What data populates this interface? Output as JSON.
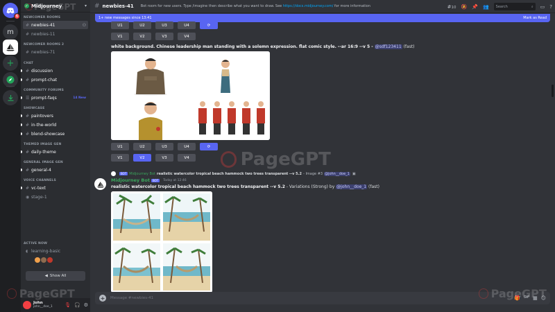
{
  "server": {
    "name": "Midjourney",
    "logo_text": "m",
    "rail_badge": "6"
  },
  "sidebar": {
    "categories": [
      {
        "label": "NEWCOMER ROOMS",
        "channels": [
          {
            "name": "newbies-41"
          },
          {
            "name": "newbies-11"
          }
        ]
      },
      {
        "label": "NEWCOMER ROOMS 2",
        "channels": [
          {
            "name": "newbies-71"
          }
        ]
      },
      {
        "label": "CHAT",
        "channels": [
          {
            "name": "discussion"
          },
          {
            "name": "prompt-chat"
          }
        ]
      },
      {
        "label": "COMMUNITY FORUMS",
        "channels": [
          {
            "name": "prompt-faqs",
            "badge": "14 New"
          }
        ]
      },
      {
        "label": "SHOWCASE",
        "channels": [
          {
            "name": "paintovers"
          },
          {
            "name": "in-the-world"
          },
          {
            "name": "blend-showcase"
          }
        ]
      },
      {
        "label": "THEMED IMAGE GEN",
        "channels": [
          {
            "name": "daily-theme"
          }
        ]
      },
      {
        "label": "GENERAL IMAGE GEN",
        "channels": [
          {
            "name": "general-4"
          }
        ]
      },
      {
        "label": "VOICE CHANNELS",
        "channels": [
          {
            "name": "vc-text"
          },
          {
            "name": "stage-1"
          }
        ]
      },
      {
        "label": "ACTIVE NOW",
        "channels": [
          {
            "name": "learning-basic"
          }
        ]
      }
    ],
    "show_all": "Show All"
  },
  "user": {
    "name": "John",
    "handle": "john__doe_1"
  },
  "topbar": {
    "channel": "newbies-41",
    "topic_prefix": "Bot room for new users. Type /imagine then describe what you want to draw. See ",
    "topic_link": "https://docs.midjourney.com/",
    "topic_suffix": " for more information",
    "count": "10",
    "search_placeholder": "Search"
  },
  "newbar": {
    "text": "1+ new messages since 13:41",
    "mark": "Mark as Read"
  },
  "buttons": {
    "u1": "U1",
    "u2": "U2",
    "u3": "U3",
    "u4": "U4",
    "v1": "V1",
    "v2": "V2",
    "v3": "V3",
    "v4": "V4"
  },
  "message1": {
    "prompt": "white background. Chinese leadership man standing with a solemn expression. flat comic style. --ar 16:9 --v 5 -",
    "mention": "@sdf123411",
    "suffix": "(fast)"
  },
  "message2": {
    "reply_bot": "BOT",
    "reply_name": "Midjourney Bot",
    "reply_text": "realistic watercolor tropical beach hammock two trees transparent --v 5.2",
    "reply_suffix": "- Image #3",
    "reply_mention": "@john__doe_1",
    "author": "Midjourney Bot",
    "bot_tag": "BOT",
    "timestamp": "Today at 12:46",
    "prompt": "realistic watercolor tropical beach hammock two trees transparent --v 5.2",
    "variation_text": "- Variations (Strong) by",
    "mention": "@john__doe_1",
    "suffix": "(fast)"
  },
  "composer": {
    "placeholder": "Message #newbies-41"
  },
  "watermark": "PageGPT"
}
